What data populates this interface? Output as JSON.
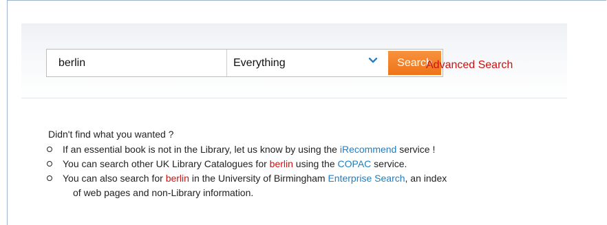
{
  "search": {
    "query": "berlin",
    "scope_selected": "Everything",
    "button_label": "Search",
    "advanced_label": "Advanced Search"
  },
  "suggestions": {
    "heading": "Didn't find what you wanted ?",
    "item1": {
      "before": "If an essential book is not in the Library, let us know by using the ",
      "link": "iRecommend",
      "after": " service !"
    },
    "item2": {
      "before": "You can search other UK Library Catalogues for ",
      "term": "berlin",
      "middle": " using the ",
      "link": "COPAC",
      "after": " service."
    },
    "item3": {
      "before": "You can also search for ",
      "term": "berlin",
      "middle": " in the University of Birmingham ",
      "link": "Enterprise Search",
      "after": ", an index",
      "continuation": "of web pages and non-Library information."
    }
  },
  "colors": {
    "accent_orange": "#ee7418",
    "link_blue": "#1a7fc4",
    "term_red": "#cc1111"
  }
}
